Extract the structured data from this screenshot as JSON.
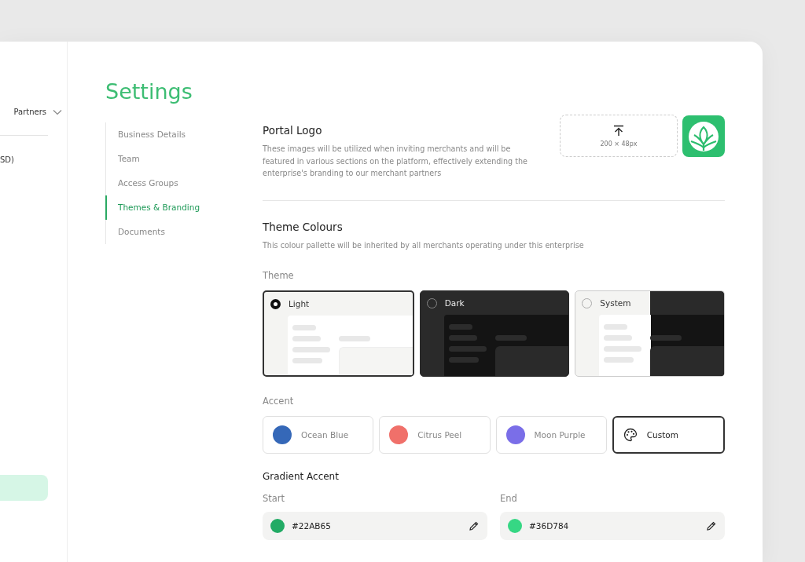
{
  "sidebar": {
    "account": {
      "label": "Partners",
      "expanded": false
    },
    "currency": "SD)"
  },
  "title": "Settings",
  "nav": [
    {
      "label": "Business Details",
      "selected": false
    },
    {
      "label": "Team",
      "selected": false
    },
    {
      "label": "Access Groups",
      "selected": false
    },
    {
      "label": "Themes & Branding",
      "selected": true
    },
    {
      "label": "Documents",
      "selected": false
    }
  ],
  "portal_logo": {
    "heading": "Portal Logo",
    "description": "These images will be utilized when inviting merchants and will be featured in various sections on the platform, effectively extending the enterprise's branding to our merchant partners",
    "upload_hint": "200 × 48px"
  },
  "theme_colours": {
    "heading": "Theme Colours",
    "description": "This colour pallette will be inherited by all merchants operating under this enterprise",
    "theme_label": "Theme",
    "themes": [
      {
        "label": "Light",
        "kind": "light",
        "selected": true
      },
      {
        "label": "Dark",
        "kind": "dark",
        "selected": false
      },
      {
        "label": "System",
        "kind": "system",
        "selected": false
      }
    ],
    "accent_label": "Accent",
    "accents": [
      {
        "label": "Ocean Blue",
        "kind": "swatch",
        "color": "#3568b8",
        "selected": false
      },
      {
        "label": "Citrus Peel",
        "kind": "swatch",
        "color": "#f0706a",
        "selected": false
      },
      {
        "label": "Moon Purple",
        "kind": "swatch",
        "color": "#7a6ee8",
        "selected": false
      },
      {
        "label": "Custom",
        "kind": "custom",
        "selected": true
      }
    ],
    "gradient_heading": "Gradient Accent",
    "gradient_fields": [
      {
        "label": "Start",
        "value": "#22AB65",
        "color": "#22ab65"
      },
      {
        "label": "End",
        "value": "#36D784",
        "color": "#36d784"
      }
    ]
  }
}
